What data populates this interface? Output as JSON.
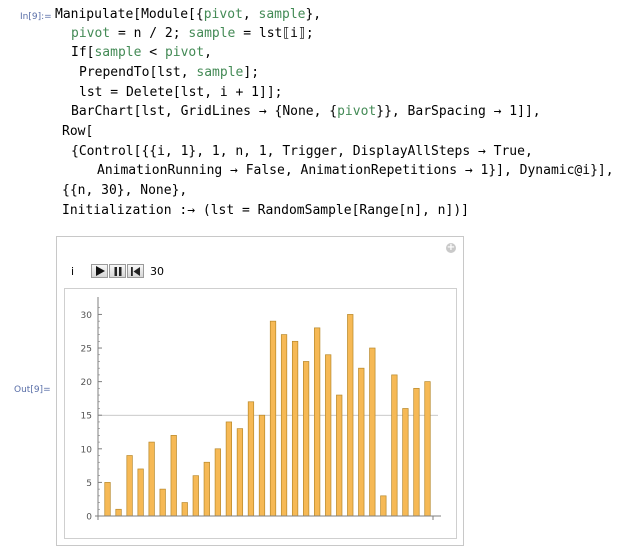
{
  "cells": {
    "input_label": "In[9]:=",
    "output_label": "Out[9]="
  },
  "code_lines": [
    [
      {
        "t": "Manipulate[Module[{"
      },
      {
        "t": "pivot",
        "c": "g"
      },
      {
        "t": ", "
      },
      {
        "t": "sample",
        "c": "g"
      },
      {
        "t": "},"
      }
    ],
    [
      {
        "t": "pivot",
        "c": "g"
      },
      {
        "t": " = n / 2; "
      },
      {
        "t": "sample",
        "c": "g"
      },
      {
        "t": " = lst⟦i⟧;"
      }
    ],
    [
      {
        "t": "If["
      },
      {
        "t": "sample",
        "c": "g"
      },
      {
        "t": " < "
      },
      {
        "t": "pivot",
        "c": "g"
      },
      {
        "t": ","
      }
    ],
    [
      {
        "t": "PrependTo[lst, "
      },
      {
        "t": "sample",
        "c": "g"
      },
      {
        "t": "];"
      }
    ],
    [
      {
        "t": "lst = Delete[lst, i + 1]];"
      }
    ],
    [
      {
        "t": "BarChart[lst, GridLines → {None, {"
      },
      {
        "t": "pivot",
        "c": "g"
      },
      {
        "t": "}}, BarSpacing → 1]],"
      }
    ],
    [
      {
        "t": "Row["
      }
    ],
    [
      {
        "t": "{Control[{{i, 1}, 1, n, 1, Trigger, DisplayAllSteps → True,"
      }
    ],
    [
      {
        "t": "AnimationRunning → False, AnimationRepetitions → 1}], Dynamic@i}],"
      }
    ],
    [
      {
        "t": "{{n, 30}, None},"
      }
    ],
    [
      {
        "t": "Initialization :→ (lst = RandomSample[Range[n], n])]"
      }
    ]
  ],
  "control": {
    "variable_label": "i",
    "value": "30",
    "play_icon": "play-icon",
    "pause_icon": "pause-icon",
    "reset_icon": "reset-icon",
    "add_icon": "plus-icon"
  },
  "colors": {
    "bar_fill": "#f6b955",
    "bar_stroke": "#b7882a",
    "gridline": "#b8b8b8",
    "axis": "#7f7f7f",
    "code_green": "#438a55"
  },
  "chart_data": {
    "type": "bar",
    "values": [
      5,
      1,
      9,
      7,
      11,
      4,
      12,
      2,
      6,
      8,
      10,
      14,
      13,
      17,
      15,
      29,
      27,
      26,
      23,
      28,
      24,
      18,
      30,
      22,
      25,
      3,
      21,
      16,
      19,
      20
    ],
    "ylim": [
      0,
      32
    ],
    "yticks": [
      0,
      5,
      10,
      15,
      20,
      25,
      30
    ],
    "gridlines_y": [
      15
    ],
    "title": "",
    "xlabel": "",
    "ylabel": ""
  }
}
